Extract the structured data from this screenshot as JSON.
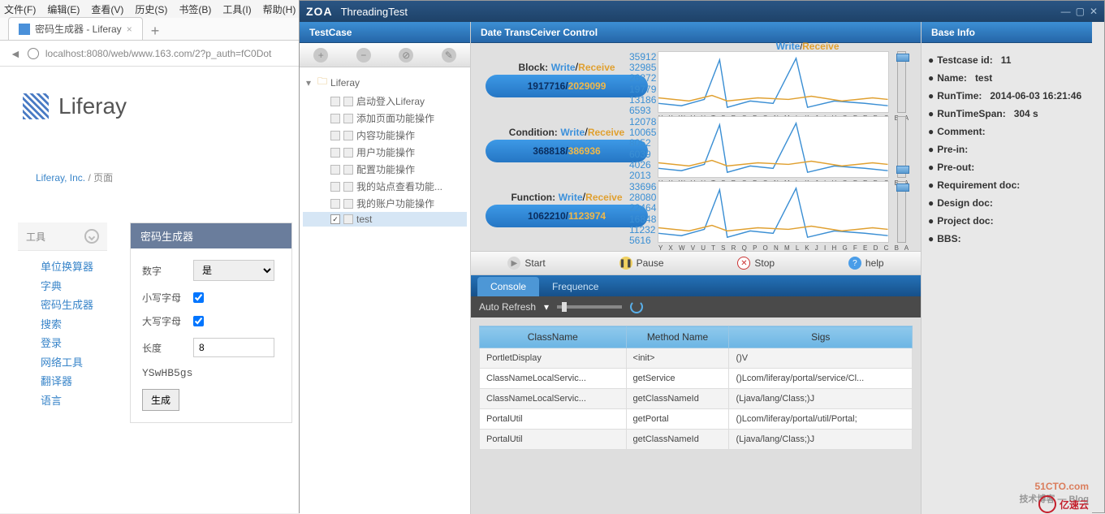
{
  "browser": {
    "menu": [
      "文件(F)",
      "编辑(E)",
      "查看(V)",
      "历史(S)",
      "书签(B)",
      "工具(I)",
      "帮助(H)"
    ],
    "tab_title": "密码生成器 - Liferay",
    "url": "localhost:8080/web/www.163.com/2?p_auth=fC0Dot"
  },
  "liferay": {
    "name": "Liferay",
    "crumb_link": "Liferay, Inc.",
    "crumb_sep": " / ",
    "crumb_current": "页面",
    "tools_header": "工具",
    "tools": [
      "单位换算器",
      "字典",
      "密码生成器",
      "搜索",
      "登录",
      "网络工具",
      "翻译器",
      "语言"
    ],
    "gen_title": "密码生成器",
    "form": {
      "digits_label": "数字",
      "digits_value": "是",
      "lower_label": "小写字母",
      "upper_label": "大写字母",
      "length_label": "长度",
      "length_value": "8",
      "result": "YSwHB5gs",
      "button": "生成"
    }
  },
  "app": {
    "logo": "ZOA",
    "title": "ThreadingTest",
    "testcase": {
      "header": "TestCase",
      "root": "Liferay",
      "children": [
        "启动登入Liferay",
        "添加页面功能操作",
        "内容功能操作",
        "用户功能操作",
        "配置功能操作",
        "我的站点查看功能...",
        "我的账户功能操作",
        "test"
      ],
      "selected_index": 7
    },
    "mid": {
      "header": "Date TransCeiver Control",
      "chart_legend_w": "Write",
      "chart_legend_r": "Receive",
      "block_label": "Block:",
      "block_w": "1917716",
      "block_r": "2029099",
      "cond_label": "Condition:",
      "cond_w": "368818",
      "cond_r": "386936",
      "func_label": "Function:",
      "func_w": "1062210",
      "func_r": "1123974",
      "y1": [
        "35912",
        "32985",
        "26372",
        "19779",
        "13186",
        "6593"
      ],
      "y2": [
        "12078",
        "10065",
        "8052",
        "6039",
        "4026",
        "2013"
      ],
      "y3": [
        "33696",
        "28080",
        "22464",
        "16848",
        "11232",
        "5616"
      ],
      "xletters": "Y X W V U T S R Q P O N M L K J I H G F E D C B A",
      "start": "Start",
      "pause": "Pause",
      "stop": "Stop",
      "help": "help",
      "tab_console": "Console",
      "tab_freq": "Frequence",
      "autorefresh": "Auto Refresh",
      "cols": [
        "ClassName",
        "Method Name",
        "Sigs"
      ],
      "rows": [
        [
          "PortletDisplay",
          "<init>",
          "()V"
        ],
        [
          "ClassNameLocalServic...",
          "getService",
          "()Lcom/liferay/portal/service/Cl..."
        ],
        [
          "ClassNameLocalServic...",
          "getClassNameId",
          "(Ljava/lang/Class;)J"
        ],
        [
          "PortalUtil",
          "getPortal",
          "()Lcom/liferay/portal/util/Portal;"
        ],
        [
          "PortalUtil",
          "getClassNameId",
          "(Ljava/lang/Class;)J"
        ]
      ]
    },
    "info": {
      "header": "Base Info",
      "rows": [
        [
          "Testcase id:",
          "11"
        ],
        [
          "Name:",
          "test"
        ],
        [
          "RunTime:",
          "2014-06-03 16:21:46"
        ],
        [
          "RunTimeSpan:",
          "304 s"
        ],
        [
          "Comment:",
          ""
        ],
        [
          "Pre-in:",
          ""
        ],
        [
          "Pre-out:",
          ""
        ],
        [
          "Requirement doc:",
          ""
        ],
        [
          "Design doc:",
          ""
        ],
        [
          "Project doc:",
          ""
        ],
        [
          "BBS:",
          ""
        ]
      ]
    }
  },
  "watermark": {
    "t1": "51CTO.com",
    "t2": "技术博客 — Blog",
    "t3": "亿速云"
  },
  "chart_data": {
    "type": "line",
    "note": "Three small line charts showing Write vs Receive counts over letters A..Y on x-axis. Values spike near letters R and I; otherwise low baseline.",
    "x": [
      "Y",
      "X",
      "W",
      "V",
      "U",
      "T",
      "S",
      "R",
      "Q",
      "P",
      "O",
      "N",
      "M",
      "L",
      "K",
      "J",
      "I",
      "H",
      "G",
      "F",
      "E",
      "D",
      "C",
      "B",
      "A"
    ],
    "charts": [
      {
        "name": "Block",
        "ylim": [
          0,
          35912
        ],
        "write_peak": 35912,
        "receive_baseline": 6593
      },
      {
        "name": "Condition",
        "ylim": [
          0,
          12078
        ],
        "write_peak": 12078,
        "receive_baseline": 2013
      },
      {
        "name": "Function",
        "ylim": [
          0,
          33696
        ],
        "write_peak": 33696,
        "receive_baseline": 5616
      }
    ]
  }
}
